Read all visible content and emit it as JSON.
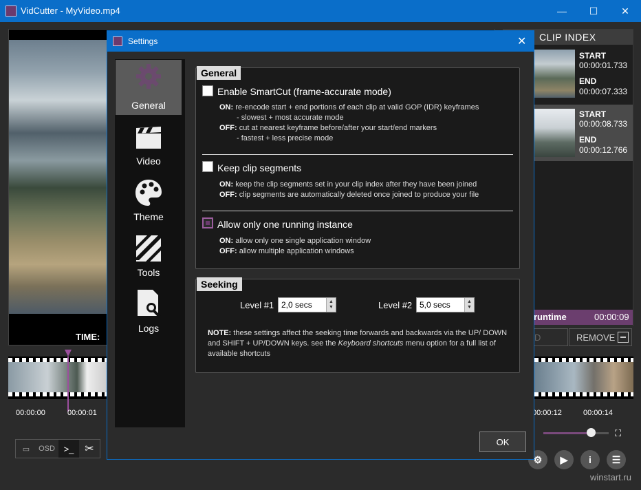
{
  "window": {
    "title": "VidCutter - MyVideo.mp4",
    "minimize": "—",
    "maximize": "☐",
    "close": "✕"
  },
  "player": {
    "time_label": "TIME:"
  },
  "clip_index": {
    "header": "CLIP INDEX",
    "clips": [
      {
        "start_label": "START",
        "start": "00:00:01.733",
        "end_label": "END",
        "end": "00:00:07.333"
      },
      {
        "start_label": "START",
        "start": "00:00:08.733",
        "end_label": "END",
        "end": "00:00:12.766"
      }
    ],
    "runtime_label": "runtime",
    "runtime_value": "00:00:09",
    "remove_label": "REMOVE",
    "add_label": "D"
  },
  "timeline": {
    "ticks": [
      "00:00:00",
      "00:00:01",
      "00:00:12",
      "00:00:14"
    ]
  },
  "toolbar": {
    "osd": "OSD",
    "console": ">_",
    "cut": "✂"
  },
  "watermark": "winstart.ru",
  "dialog": {
    "title": "Settings",
    "close": "✕",
    "nav": [
      {
        "label": "General",
        "icon": "gear-icon"
      },
      {
        "label": "Video",
        "icon": "clapperboard-icon"
      },
      {
        "label": "Theme",
        "icon": "palette-icon"
      },
      {
        "label": "Tools",
        "icon": "tools-icon"
      },
      {
        "label": "Logs",
        "icon": "log-file-icon"
      }
    ],
    "general": {
      "heading": "General",
      "smartcut": {
        "label": "Enable SmartCut (frame-accurate mode)",
        "on_key": "ON:",
        "on_text": "re-encode start + end portions of each clip at valid GOP (IDR) keyframes",
        "on_sub": "- slowest + most accurate mode",
        "off_key": "OFF:",
        "off_text": "cut at nearest keyframe before/after your start/end markers",
        "off_sub": "- fastest + less precise mode"
      },
      "keep": {
        "label": "Keep clip segments",
        "on_key": "ON:",
        "on_text": "keep the clip segments set in your clip index after they have been joined",
        "off_key": "OFF:",
        "off_text": "clip segments are automatically deleted once joined to produce your file"
      },
      "single": {
        "label": "Allow only one running instance",
        "on_key": "ON:",
        "on_text": "allow only one single application window",
        "off_key": "OFF:",
        "off_text": "allow multiple application windows"
      }
    },
    "seeking": {
      "heading": "Seeking",
      "level1_label": "Level #1",
      "level1_value": "2,0 secs",
      "level2_label": "Level #2",
      "level2_value": "5,0 secs",
      "note_key": "NOTE:",
      "note_text1": "these settings affect the seeking time forwards and backwards via the UP/ DOWN and SHIFT + UP/DOWN keys. see the",
      "note_em": "Keyboard shortcuts",
      "note_text2": "menu option for a full list of available shortcuts"
    },
    "ok": "OK"
  },
  "colors": {
    "accent": "#0a6ec9",
    "purple": "#6b3e6e"
  }
}
